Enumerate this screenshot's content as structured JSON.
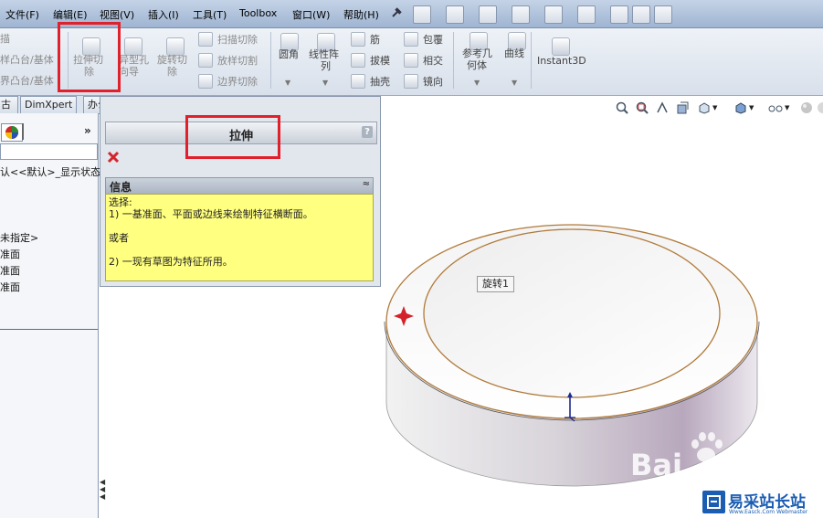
{
  "menu": [
    "文件(F)",
    "编辑(E)",
    "视图(V)",
    "插入(I)",
    "工具(T)",
    "Toolbox",
    "窗口(W)",
    "帮助(H)"
  ],
  "ribbon": {
    "left_partial": [
      "描",
      "样凸台/基体",
      "界凸台/基体"
    ],
    "extrude_cut": [
      "拉伸切",
      "除"
    ],
    "hole_wizard": [
      "异型孔",
      "向导"
    ],
    "revolve_cut": [
      "旋转切",
      "除"
    ],
    "small_cuts": [
      "扫描切除",
      "放样切割",
      "边界切除"
    ],
    "fillet": "圆角",
    "linear_pattern": [
      "线性阵",
      "列"
    ],
    "features_mid": [
      "筋",
      "拔模",
      "抽壳"
    ],
    "features_right": [
      "包覆",
      "相交",
      "镜向"
    ],
    "ref_geometry": [
      "参考几",
      "何体"
    ],
    "curves": "曲线",
    "instant3d": "Instant3D"
  },
  "tabs": [
    "古",
    "DimXpert",
    "办公室产品"
  ],
  "tree": {
    "top_line": "认<<默认>_显示状态",
    "items": [
      "未指定>",
      "准面",
      "准面",
      "准面"
    ]
  },
  "property_manager": {
    "title": "拉伸",
    "help": "?",
    "info_title": "信息",
    "info_lines": [
      "选择:",
      "1) 一基准面、平面或边线来绘制特征横断面。",
      "",
      "或者",
      "",
      "2) 一现有草图为特征所用。"
    ]
  },
  "canvas": {
    "tooltip": "旋转1"
  },
  "watermarks": {
    "baidu": "Bai",
    "site_name": "易采站长站",
    "site_url": "Www.Easck.Com Webmaster"
  },
  "colors": {
    "highlight": "#e0202a",
    "info_bg": "#ffff80",
    "menubar": "#b4c6de",
    "model_edge": "#b07a3a"
  }
}
